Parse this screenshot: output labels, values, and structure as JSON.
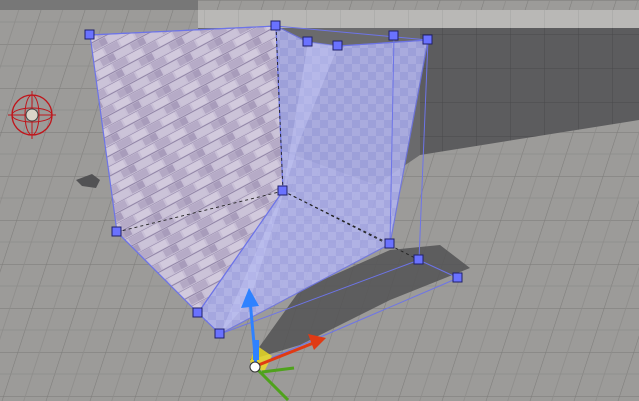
{
  "viewport": {
    "colors": {
      "floor": "#9c9b99",
      "floor_grid": "#7f7e7c",
      "wall_top": "#b9b8b6",
      "wall_front": "#5c5c5e",
      "wall_grid": "#4a4a4c",
      "shadow": "#525254",
      "brush_fill": "#9fa2e6",
      "brush_edge": "#6d74e8",
      "brick_light": "#c8bfd6",
      "brick_dark": "#9f93b1",
      "vertex": "#6a72ff",
      "gizmo_x": "#e03a14",
      "gizmo_y": "#4fa21c",
      "gizmo_z": "#2f82ff",
      "light_icon": "#c0141a"
    },
    "objects": {
      "brush": "wedge-brush",
      "light": "point-light-icon",
      "gizmo": "translate-gizmo"
    }
  }
}
